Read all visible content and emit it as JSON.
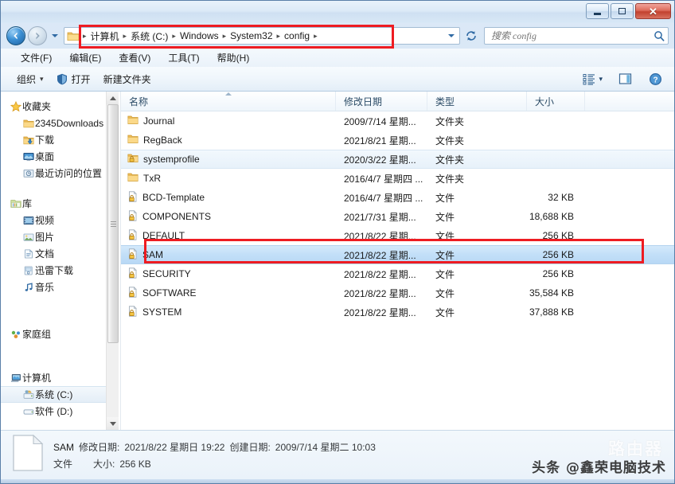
{
  "window": {
    "controls": {
      "minimize": "–",
      "maximize": "□",
      "close": "✕"
    }
  },
  "addressbar": {
    "breadcrumbs": [
      "计算机",
      "系统 (C:)",
      "Windows",
      "System32",
      "config"
    ],
    "separator": "▸",
    "folder_icon": "folder-icon",
    "dropdown_icon": "chevron-down-icon",
    "refresh_icon": "refresh-icon",
    "back_icon": "arrow-left-icon",
    "forward_icon": "arrow-right-icon",
    "recent_icon": "chevron-down-icon"
  },
  "search": {
    "placeholder": "搜索 config",
    "value": "",
    "icon": "search-icon"
  },
  "menubar": {
    "items": [
      {
        "label": "文件(F)",
        "name": "menu-file"
      },
      {
        "label": "编辑(E)",
        "name": "menu-edit"
      },
      {
        "label": "查看(V)",
        "name": "menu-view"
      },
      {
        "label": "工具(T)",
        "name": "menu-tools"
      },
      {
        "label": "帮助(H)",
        "name": "menu-help"
      }
    ]
  },
  "toolbar": {
    "organize_label": "组织",
    "organize_caret": "▾",
    "open_label": "打开",
    "open_icon": "shield-icon",
    "newfolder_label": "新建文件夹",
    "views_icon": "view-list-icon",
    "views_caret": "▾",
    "preview_icon": "preview-pane-icon",
    "help_icon": "help-icon"
  },
  "sidebar": {
    "groups": [
      {
        "header": {
          "label": "收藏夹",
          "icon": "star-icon",
          "name": "sidebar-group-favorites"
        },
        "items": [
          {
            "label": "2345Downloads",
            "icon": "folder-icon",
            "name": "sidebar-item-2345downloads",
            "selected": false
          },
          {
            "label": "下载",
            "icon": "download-folder-icon",
            "name": "sidebar-item-downloads",
            "selected": false
          },
          {
            "label": "桌面",
            "icon": "desktop-icon",
            "name": "sidebar-item-desktop",
            "selected": false
          },
          {
            "label": "最近访问的位置",
            "icon": "recent-places-icon",
            "name": "sidebar-item-recent-places",
            "selected": false
          }
        ]
      },
      {
        "header": {
          "label": "库",
          "icon": "library-icon",
          "name": "sidebar-group-libraries"
        },
        "items": [
          {
            "label": "视频",
            "icon": "video-icon",
            "name": "sidebar-item-videos",
            "selected": false
          },
          {
            "label": "图片",
            "icon": "pictures-icon",
            "name": "sidebar-item-pictures",
            "selected": false
          },
          {
            "label": "文档",
            "icon": "documents-icon",
            "name": "sidebar-item-documents",
            "selected": false
          },
          {
            "label": "迅雷下载",
            "icon": "thunder-download-icon",
            "name": "sidebar-item-thunder-download",
            "selected": false
          },
          {
            "label": "音乐",
            "icon": "music-icon",
            "name": "sidebar-item-music",
            "selected": false
          }
        ]
      },
      {
        "header": {
          "label": "家庭组",
          "icon": "homegroup-icon",
          "name": "sidebar-group-homegroup"
        },
        "items": []
      },
      {
        "header": {
          "label": "计算机",
          "icon": "computer-icon",
          "name": "sidebar-group-computer"
        },
        "items": [
          {
            "label": "系统 (C:)",
            "icon": "system-drive-icon",
            "name": "sidebar-item-system-c",
            "selected": true
          },
          {
            "label": "软件 (D:)",
            "icon": "drive-icon",
            "name": "sidebar-item-software-d",
            "selected": false
          }
        ]
      }
    ]
  },
  "filelist": {
    "columns": [
      {
        "label": "名称",
        "name": "column-name",
        "sorted": true
      },
      {
        "label": "修改日期",
        "name": "column-date-modified",
        "sorted": false
      },
      {
        "label": "类型",
        "name": "column-type",
        "sorted": false
      },
      {
        "label": "大小",
        "name": "column-size",
        "sorted": false
      }
    ],
    "rows": [
      {
        "name": "Journal",
        "date": "2009/7/14 星期...",
        "type": "文件夹",
        "size": "",
        "icon": "folder-icon",
        "state": ""
      },
      {
        "name": "RegBack",
        "date": "2021/8/21 星期...",
        "type": "文件夹",
        "size": "",
        "icon": "folder-icon",
        "state": ""
      },
      {
        "name": "systemprofile",
        "date": "2020/3/22 星期...",
        "type": "文件夹",
        "size": "",
        "icon": "locked-folder-icon",
        "state": "sel-light"
      },
      {
        "name": "TxR",
        "date": "2016/4/7 星期四 ...",
        "type": "文件夹",
        "size": "",
        "icon": "folder-icon",
        "state": ""
      },
      {
        "name": "BCD-Template",
        "date": "2016/4/7 星期四 ...",
        "type": "文件",
        "size": "32 KB",
        "icon": "locked-file-icon",
        "state": ""
      },
      {
        "name": "COMPONENTS",
        "date": "2021/7/31 星期...",
        "type": "文件",
        "size": "18,688 KB",
        "icon": "locked-file-icon",
        "state": ""
      },
      {
        "name": "DEFAULT",
        "date": "2021/8/22 星期...",
        "type": "文件",
        "size": "256 KB",
        "icon": "locked-file-icon",
        "state": ""
      },
      {
        "name": "SAM",
        "date": "2021/8/22 星期...",
        "type": "文件",
        "size": "256 KB",
        "icon": "locked-file-icon",
        "state": "sel"
      },
      {
        "name": "SECURITY",
        "date": "2021/8/22 星期...",
        "type": "文件",
        "size": "256 KB",
        "icon": "locked-file-icon",
        "state": ""
      },
      {
        "name": "SOFTWARE",
        "date": "2021/8/22 星期...",
        "type": "文件",
        "size": "35,584 KB",
        "icon": "locked-file-icon",
        "state": ""
      },
      {
        "name": "SYSTEM",
        "date": "2021/8/22 星期...",
        "type": "文件",
        "size": "37,888 KB",
        "icon": "locked-file-icon",
        "state": ""
      }
    ]
  },
  "statusbar": {
    "file_name": "SAM",
    "modified_label": "修改日期:",
    "modified_value": "2021/8/22 星期日 19:22",
    "created_label": "创建日期:",
    "created_value": "2009/7/14 星期二 10:03",
    "type_value": "文件",
    "size_label": "大小:",
    "size_value": "256 KB",
    "icon": "file-icon"
  },
  "watermark": {
    "text": "头条 @鑫荣电脑技术",
    "ghost": "路由器"
  },
  "colors": {
    "accent": "#2f6aa4",
    "annotation_red": "#ee1c22",
    "selection_blue": "#c2dff8",
    "close_red": "#c2412f"
  }
}
